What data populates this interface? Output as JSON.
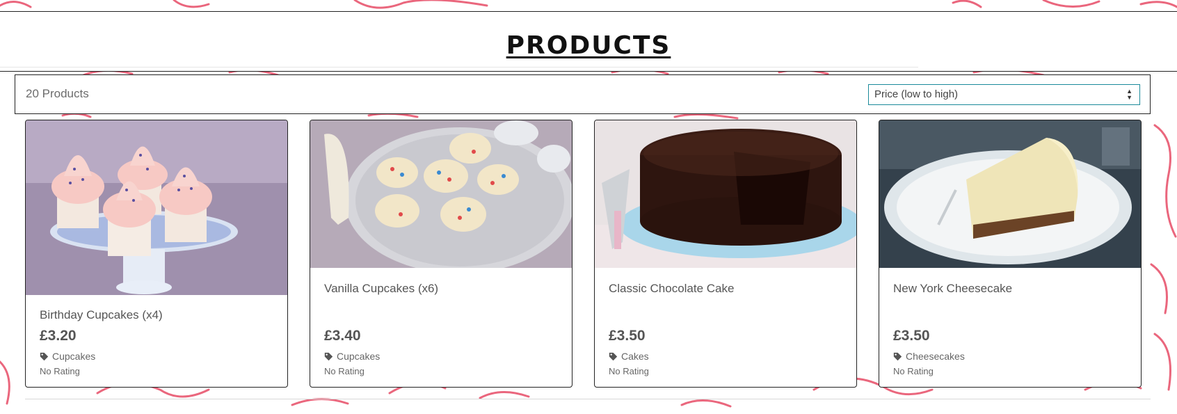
{
  "page": {
    "title": "PRODUCTS"
  },
  "toolbar": {
    "count": "20 Products",
    "sort_value": "Price (low to high)"
  },
  "colors": {
    "pattern": "#e8566f",
    "select_border": "#1a8a9a",
    "text": "#555555"
  },
  "products": [
    {
      "name": "Birthday Cupcakes (x4)",
      "price": "£3.20",
      "category": "Cupcakes",
      "rating": "No Rating",
      "icon": "tag-icon"
    },
    {
      "name": "Vanilla Cupcakes (x6)",
      "price": "£3.40",
      "category": "Cupcakes",
      "rating": "No Rating",
      "icon": "tag-icon"
    },
    {
      "name": "Classic Chocolate Cake",
      "price": "£3.50",
      "category": "Cakes",
      "rating": "No Rating",
      "icon": "tag-icon"
    },
    {
      "name": "New York Cheesecake",
      "price": "£3.50",
      "category": "Cheesecakes",
      "rating": "No Rating",
      "icon": "tag-icon"
    }
  ]
}
